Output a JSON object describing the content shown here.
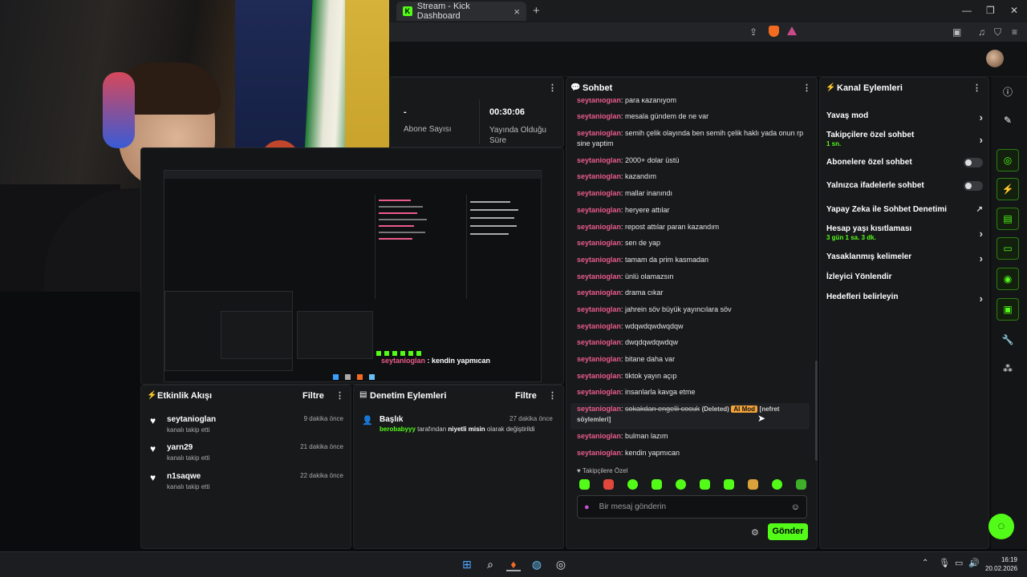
{
  "browser": {
    "tab_title": "Stream - Kick Dashboard",
    "tab_icon": "kick-logo-icon",
    "new_tab": "+",
    "minimize": "—",
    "maximize": "❐",
    "close": "✕"
  },
  "stats": {
    "subs_value": "-",
    "subs_label": "Abone Sayısı",
    "uptime_value": "00:30:06",
    "uptime_label": "Yayında Olduğu Süre"
  },
  "preview": {
    "overlay_user": "seytanioglan",
    "overlay_msg": " : kendin yapmıcan"
  },
  "activity": {
    "title": "Etkinlik Akışı",
    "filter": "Filtre",
    "items": [
      {
        "name": "seytanioglan",
        "sub": "kanalı takip etti",
        "time": "9 dakika önce"
      },
      {
        "name": "yarn29",
        "sub": "kanalı takip etti",
        "time": "21 dakika önce"
      },
      {
        "name": "n1saqwe",
        "sub": "kanalı takip etti",
        "time": "22 dakika önce"
      }
    ]
  },
  "moderation": {
    "title": "Denetim Eylemleri",
    "filter": "Filtre",
    "item_title": "Başlık",
    "item_time": "27 dakika önce",
    "item_actor": "berobabyyy",
    "item_mid": " tarafından ",
    "item_value": "niyetli misin",
    "item_tail": " olarak değiştirildi"
  },
  "chat": {
    "title": "Sohbet",
    "messages": [
      {
        "user": "seytanioglan",
        "text": ": para kazanıyom"
      },
      {
        "user": "seytanioglan",
        "text": ": mesala gündem de ne var"
      },
      {
        "user": "seytanioglan",
        "text": ": semih çelik olayında ben semih çelik haklı yada onun rp sine yaptim"
      },
      {
        "user": "seytanioglan",
        "text": ": 2000+ dolar üstü"
      },
      {
        "user": "seytanioglan",
        "text": ": kazandım"
      },
      {
        "user": "seytanioglan",
        "text": ": mallar inanındı"
      },
      {
        "user": "seytanioglan",
        "text": ": heryere attılar"
      },
      {
        "user": "seytanioglan",
        "text": ": repost attılar paran kazandım"
      },
      {
        "user": "seytanioglan",
        "text": ": sen de yap"
      },
      {
        "user": "seytanioglan",
        "text": ": tamam da prim kasmadan"
      },
      {
        "user": "seytanioglan",
        "text": ": ünlü olamazsın"
      },
      {
        "user": "seytanioglan",
        "text": ": drama cıkar"
      },
      {
        "user": "seytanioglan",
        "text": ": jahrein söv büyük yayıncılara söv"
      },
      {
        "user": "seytanioglan",
        "text": ": wdqwdqwdwqdqw"
      },
      {
        "user": "seytanioglan",
        "text": ": dwqdqwdqwdqw"
      },
      {
        "user": "seytanioglan",
        "text": ": bitane daha var"
      },
      {
        "user": "seytanioglan",
        "text": ": tiktok yayın açıp"
      },
      {
        "user": "seytanioglan",
        "text": ": insanlarla kavga etme"
      }
    ],
    "deleted": {
      "user": "seytanioglan",
      "text": "sokakdan engelli cocuk",
      "tag": "(Deleted)",
      "badge": "AI Mod",
      "reason": "[nefret söylemleri]"
    },
    "messages2": [
      {
        "user": "seytanioglan",
        "text": ": bulman lazım"
      },
      {
        "user": "seytanioglan",
        "text": ": kendin yapmıcan"
      }
    ],
    "followers_only": "Takipçilere Özel",
    "input_placeholder": "Bir mesaj gönderin",
    "send_label": "Gönder"
  },
  "channel": {
    "title": "Kanal Eylemleri",
    "slow_mode": "Yavaş mod",
    "followers_chat": "Takipçilere özel sohbet",
    "followers_chat_sub": "1 sn.",
    "subs_chat": "Abonelere özel sohbet",
    "emote_chat": "Yalnızca ifadelerle sohbet",
    "ai_mod": "Yapay Zeka ile Sohbet Denetimi",
    "age_limit": "Hesap yaşı kısıtlaması",
    "age_limit_sub": "3 gün 1 sa. 3 dk.",
    "banned_words": "Yasaklanmış kelimeler",
    "redirect": "İzleyici Yönlendir",
    "goals": "Hedefleri belirleyin",
    "toggles": {
      "subs_chat": false,
      "emote_chat": false
    }
  },
  "taskbar": {
    "time": "16:19",
    "date": "20.02.2026"
  },
  "colors": {
    "accent": "#53fc18",
    "username": "#ea5c8a",
    "panel": "#18191b"
  }
}
